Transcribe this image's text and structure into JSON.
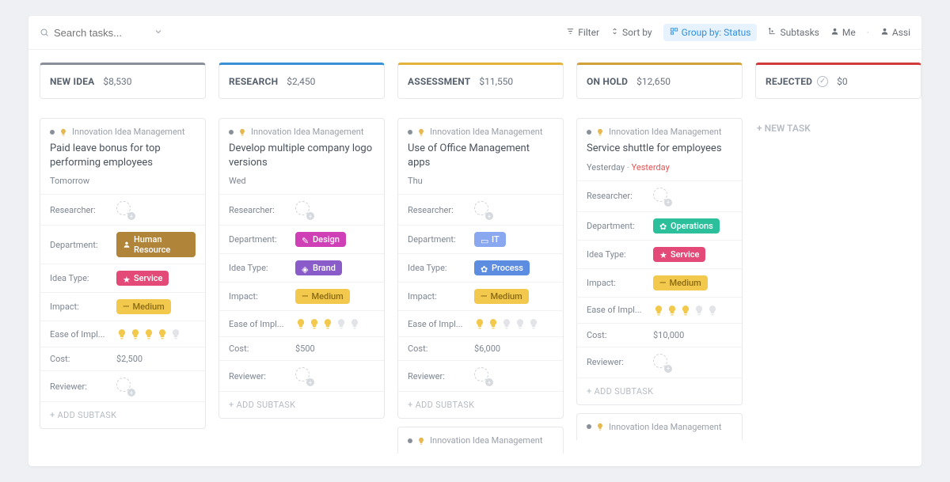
{
  "toolbar": {
    "search_placeholder": "Search tasks...",
    "filter": "Filter",
    "sortby": "Sort by",
    "groupby": "Group by: Status",
    "subtasks": "Subtasks",
    "me": "Me",
    "assi": "Assi"
  },
  "columns": [
    {
      "id": "new-idea",
      "title": "NEW IDEA",
      "amount": "$8,530",
      "color": "#8a9099"
    },
    {
      "id": "research",
      "title": "RESEARCH",
      "amount": "$2,450",
      "color": "#3a92d6"
    },
    {
      "id": "assessment",
      "title": "ASSESSMENT",
      "amount": "$11,550",
      "color": "#e3b23a"
    },
    {
      "id": "onhold",
      "title": "ON HOLD",
      "amount": "$12,650",
      "color": "#d1a23a"
    },
    {
      "id": "rejected",
      "title": "REJECTED",
      "amount": "$0",
      "color": "#d23a3a",
      "showCheck": true
    }
  ],
  "newTaskLabel": "+ NEW TASK",
  "addSubtaskLabel": "+ ADD SUBTASK",
  "projectLabel": "Innovation Idea Management",
  "fieldLabels": {
    "researcher": "Researcher:",
    "department": "Department:",
    "ideaType": "Idea Type:",
    "impact": "Impact:",
    "ease": "Ease of Impl...",
    "cost": "Cost:",
    "reviewer": "Reviewer:"
  },
  "cards": {
    "newidea": {
      "title": "Paid leave bonus for top performing employees",
      "due": "Tomorrow",
      "department": "Human Resource",
      "deptClass": "hr",
      "ideaType": "Service",
      "ideaClass": "svc",
      "impact": "Medium",
      "bulbs": 4,
      "cost": "$2,500"
    },
    "research": {
      "title": "Develop multiple company logo versions",
      "due": "Wed",
      "department": "Design",
      "deptClass": "design",
      "ideaType": "Brand",
      "ideaClass": "brand",
      "impact": "Medium",
      "bulbs": 3,
      "cost": "$500"
    },
    "assessment": {
      "title": "Use of Office Management apps",
      "due": "Thu",
      "department": "IT",
      "deptClass": "it",
      "ideaType": "Process",
      "ideaClass": "proc",
      "impact": "Medium",
      "bulbs": 2,
      "cost": "$6,000"
    },
    "onhold": {
      "title": "Service shuttle for employees",
      "due": "Yesterday",
      "dueLate": "Yesterday",
      "department": "Operations",
      "deptClass": "ops",
      "ideaType": "Service",
      "ideaClass": "svc",
      "impact": "Medium",
      "bulbs": 3,
      "cost": "$10,000"
    }
  }
}
